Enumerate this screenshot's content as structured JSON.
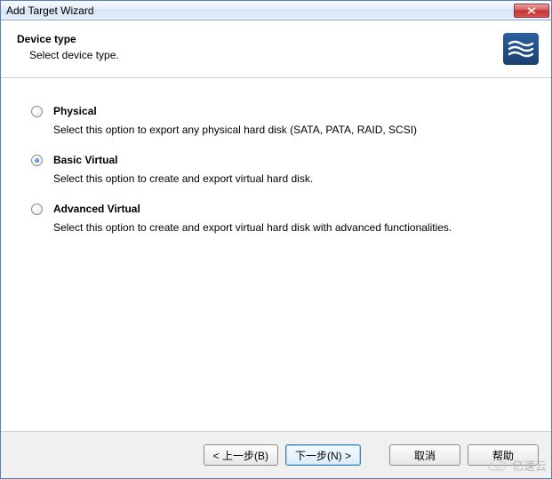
{
  "window": {
    "title": "Add Target Wizard"
  },
  "header": {
    "title": "Device type",
    "subtitle": "Select device type."
  },
  "options": {
    "physical": {
      "label": "Physical",
      "desc": "Select this option to export any physical hard disk (SATA, PATA, RAID, SCSI)"
    },
    "basic_virtual": {
      "label": "Basic Virtual",
      "desc": "Select this option to create and export virtual hard disk."
    },
    "advanced_virtual": {
      "label": "Advanced Virtual",
      "desc": "Select this option to create and export virtual hard disk with advanced functionalities."
    }
  },
  "selected_option": "basic_virtual",
  "buttons": {
    "back": "< 上一步(B)",
    "next": "下一步(N) >",
    "cancel": "取消",
    "help": "帮助"
  },
  "watermark": "亿速云"
}
